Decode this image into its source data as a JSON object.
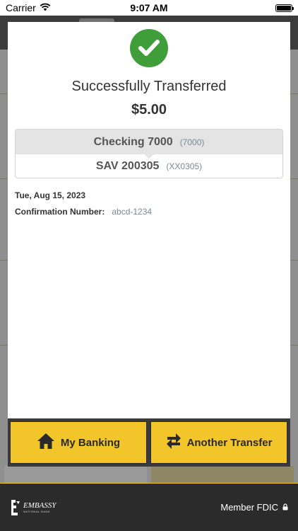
{
  "status_bar": {
    "carrier": "Carrier",
    "time": "9:07 AM"
  },
  "modal": {
    "title": "Successfully Transferred",
    "amount": "$5.00",
    "from_account": {
      "name": "Checking 7000",
      "number": "(7000)"
    },
    "to_account": {
      "name": "SAV 200305",
      "number": "(XX0305)"
    },
    "date": "Tue, Aug 15, 2023",
    "confirmation_label": "Confirmation Number:",
    "confirmation_value": "abcd-1234"
  },
  "actions": {
    "my_banking_label": "My Banking",
    "another_transfer_label": "Another Transfer"
  },
  "footer": {
    "logo_text": "EMBASSY",
    "logo_sub": "NATIONAL BANK",
    "member_fdic": "Member FDIC"
  },
  "colors": {
    "accent_yellow": "#f2c62a",
    "success_green": "#3f9e3a",
    "dark_bg": "#2b2b2b"
  },
  "icons": {
    "wifi": "wifi-icon",
    "battery": "battery-icon",
    "check": "check-icon",
    "home": "home-icon",
    "transfer": "transfer-arrows-icon",
    "lock": "lock-icon",
    "logo": "embassy-logo-icon"
  }
}
